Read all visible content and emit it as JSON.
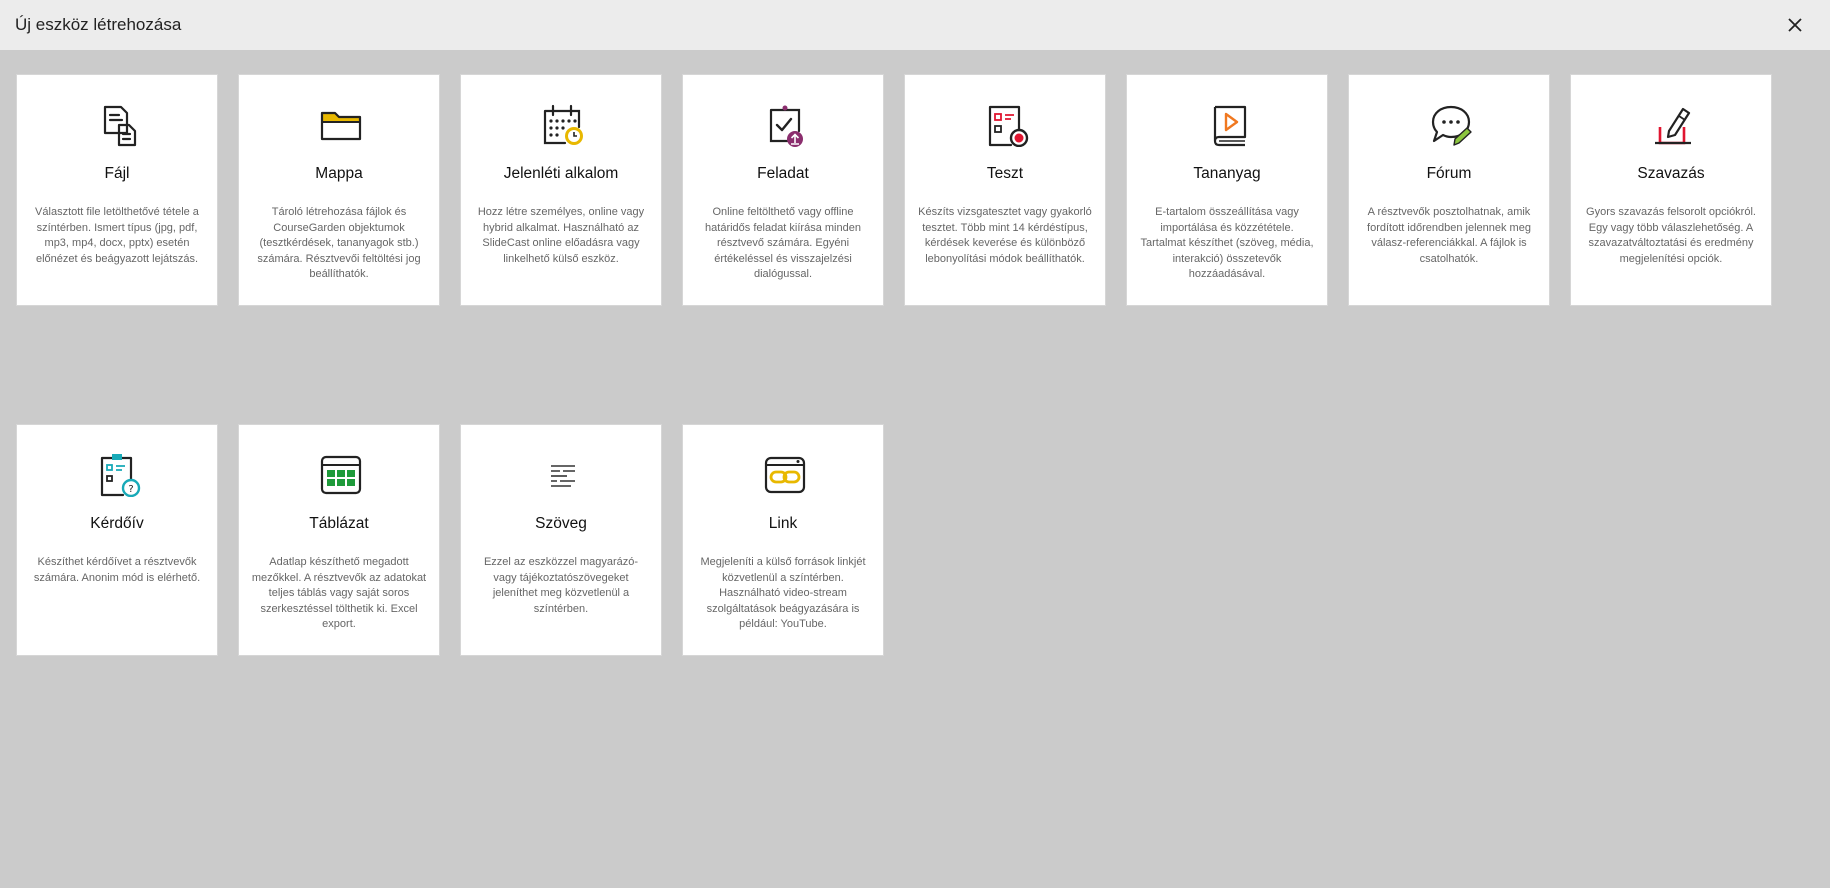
{
  "header": {
    "title": "Új eszköz létrehozása",
    "close_icon": "close-icon"
  },
  "cards": [
    {
      "key": "fajl",
      "name": "Fájl",
      "icon": "file-icon",
      "desc": "Választott file letölthetővé tétele a színtérben. Ismert típus (jpg, pdf, mp3, mp4, docx, pptx) esetén előnézet és beágyazott lejátszás."
    },
    {
      "key": "mappa",
      "name": "Mappa",
      "icon": "folder-icon",
      "desc": "Tároló létrehozása fájlok és CourseGarden objektumok (tesztkérdések, tananyagok stb.) számára. Résztvevői feltöltési jog beállíthatók."
    },
    {
      "key": "jelenleti",
      "name": "Jelenléti alkalom",
      "icon": "calendar-clock-icon",
      "desc": "Hozz létre személyes, online vagy hybrid alkalmat. Használható az SlideCast online előadásra vagy linkelhető külső eszköz."
    },
    {
      "key": "feladat",
      "name": "Feladat",
      "icon": "task-upload-icon",
      "desc": "Online feltölthető vagy offline határidős feladat kiírása minden résztvevő számára. Egyéni értékeléssel és visszajelzési dialógussal."
    },
    {
      "key": "teszt",
      "name": "Teszt",
      "icon": "test-icon",
      "desc": "Készíts vizsgatesztet vagy gyakorló tesztet. Több mint 14 kérdéstípus, kérdések keverése és különböző lebonyolítási módok beállíthatók."
    },
    {
      "key": "tananyag",
      "name": "Tananyag",
      "icon": "book-play-icon",
      "desc": "E-tartalom összeállítása vagy importálása és közzététele. Tartalmat készíthet (szöveg, média, interakció) összetevők hozzáadásával."
    },
    {
      "key": "forum",
      "name": "Fórum",
      "icon": "chat-bubble-icon",
      "desc": "A résztvevők posztolhatnak, amik fordított időrendben jelennek meg válasz-referenciákkal. A fájlok is csatolhatók."
    },
    {
      "key": "szavazas",
      "name": "Szavazás",
      "icon": "ballot-box-icon",
      "desc": "Gyors szavazás felsorolt opciókról. Egy vagy több válaszlehetőség. A szavazatváltoztatási és eredmény megjelenítési opciók."
    },
    {
      "key": "kerdoiv",
      "name": "Kérdőív",
      "icon": "questionnaire-icon",
      "desc": "Készíthet kérdőívet a résztvevők számára. Anonim mód is elérhető."
    },
    {
      "key": "tablazat",
      "name": "Táblázat",
      "icon": "table-icon",
      "desc": "Adatlap készíthető megadott mezőkkel. A résztvevők az adatokat teljes táblás vagy saját soros szerkesztéssel tölthetik ki. Excel export."
    },
    {
      "key": "szoveg",
      "name": "Szöveg",
      "icon": "text-lines-icon",
      "desc": "Ezzel az eszközzel magyarázó- vagy tájékoztatószövegeket jeleníthet meg közvetlenül a színtérben."
    },
    {
      "key": "link",
      "name": "Link",
      "icon": "link-window-icon",
      "desc": "Megjeleníti a külső források linkjét közvetlenül a színtérben. Használható video-stream szolgáltatások beágyazására is például: YouTube."
    }
  ],
  "colors": {
    "accent_yellow": "#e8b800",
    "accent_purple": "#8b2e6e",
    "accent_red": "#e01530",
    "accent_orange": "#f07820",
    "accent_green": "#8cc63f",
    "accent_teal": "#18aab8",
    "table_green": "#1e9a3a"
  }
}
